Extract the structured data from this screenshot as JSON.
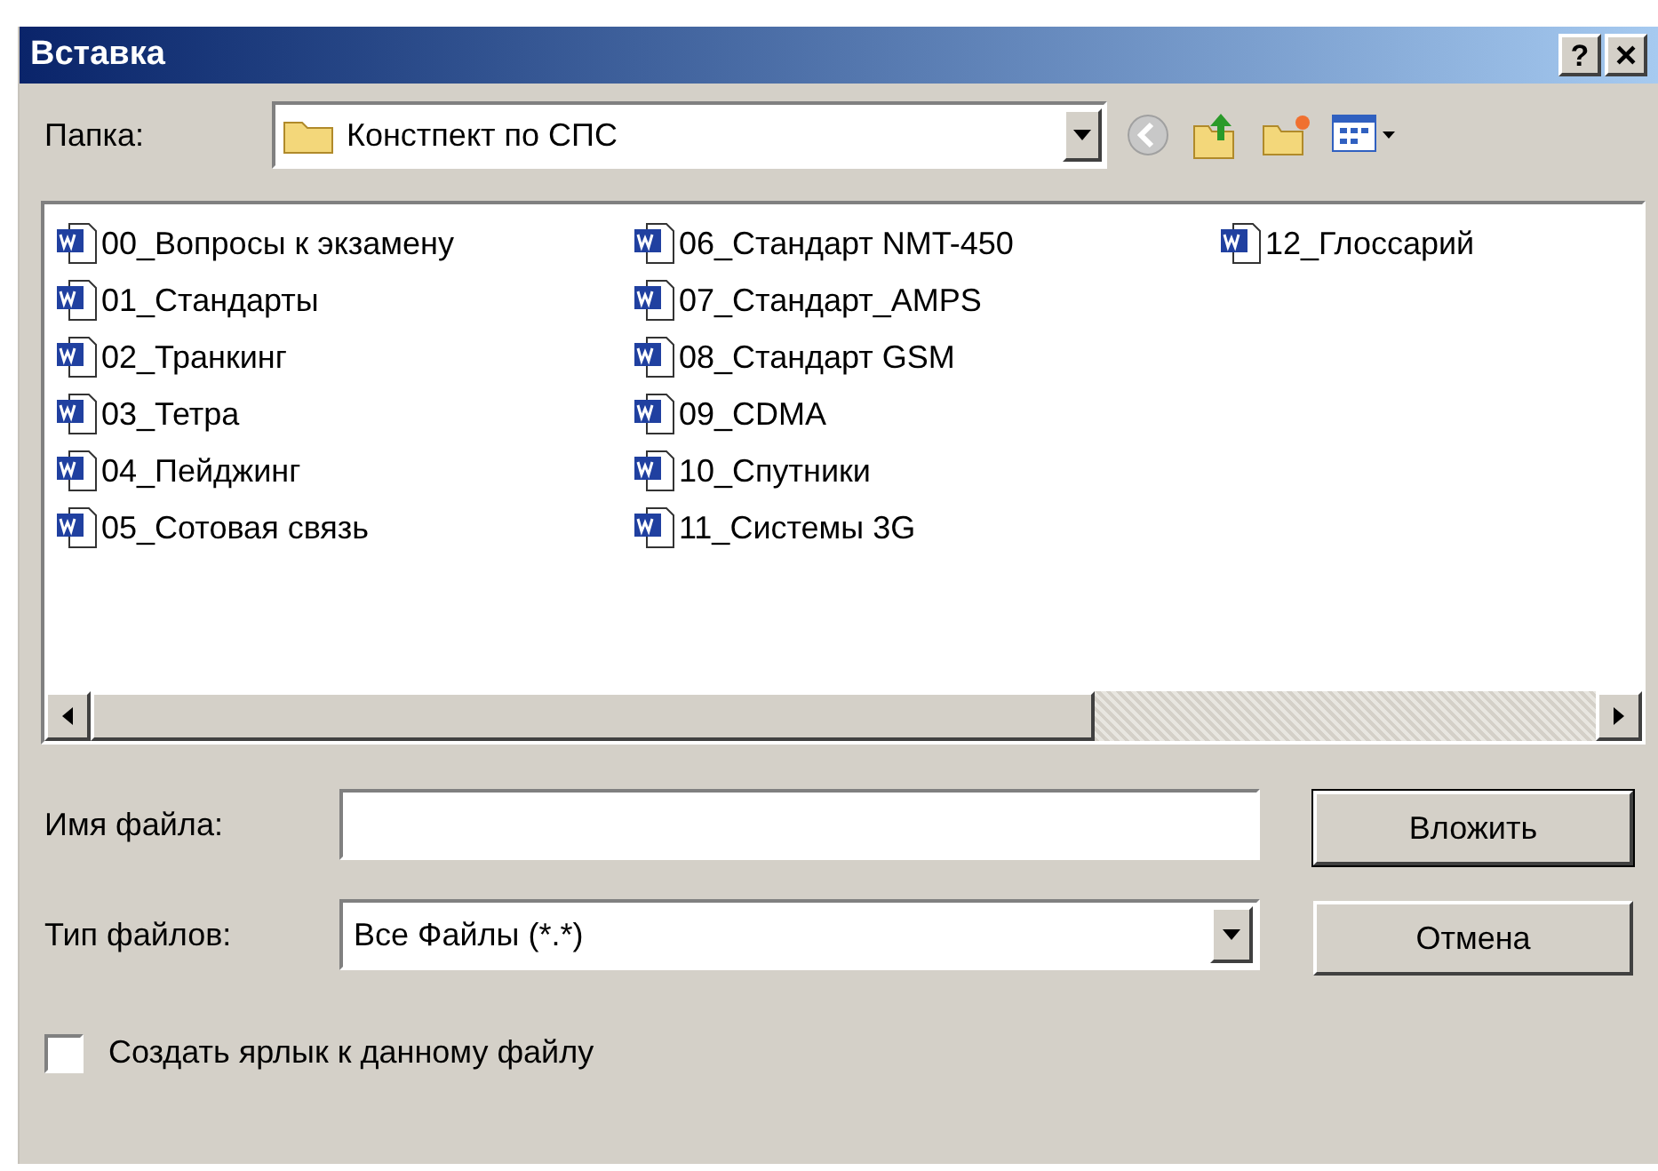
{
  "window": {
    "title": "Вставка",
    "buttons": [
      {
        "kind": "help",
        "label": "?"
      },
      {
        "kind": "close",
        "label": "×"
      }
    ]
  },
  "folder": {
    "label": "Папка:",
    "value": "Констпект по СПС"
  },
  "files": [
    {
      "name": "00_Вопросы к экзамену"
    },
    {
      "name": "01_Стандарты"
    },
    {
      "name": "02_Транкинг"
    },
    {
      "name": "03_Тетра"
    },
    {
      "name": "04_Пейджинг"
    },
    {
      "name": "05_Сотовая связь"
    },
    {
      "name": "06_Стандарт NMT-450"
    },
    {
      "name": "07_Стандарт_AMPS"
    },
    {
      "name": "08_Стандарт GSM"
    },
    {
      "name": "09_CDMA"
    },
    {
      "name": "10_Спутники"
    },
    {
      "name": "11_Системы 3G"
    },
    {
      "name": "12_Глоссарий"
    }
  ],
  "file_name": {
    "label": "Имя файла:"
  },
  "file_type": {
    "label": "Тип файлов:",
    "value": "Все Файлы (*.*)"
  },
  "buttons": [
    {
      "label": "Вложить",
      "default": true
    },
    {
      "label": "Отмена",
      "default": false
    }
  ],
  "shortcut": {
    "label": "Создать ярлык к данному файлу",
    "checked": false
  }
}
